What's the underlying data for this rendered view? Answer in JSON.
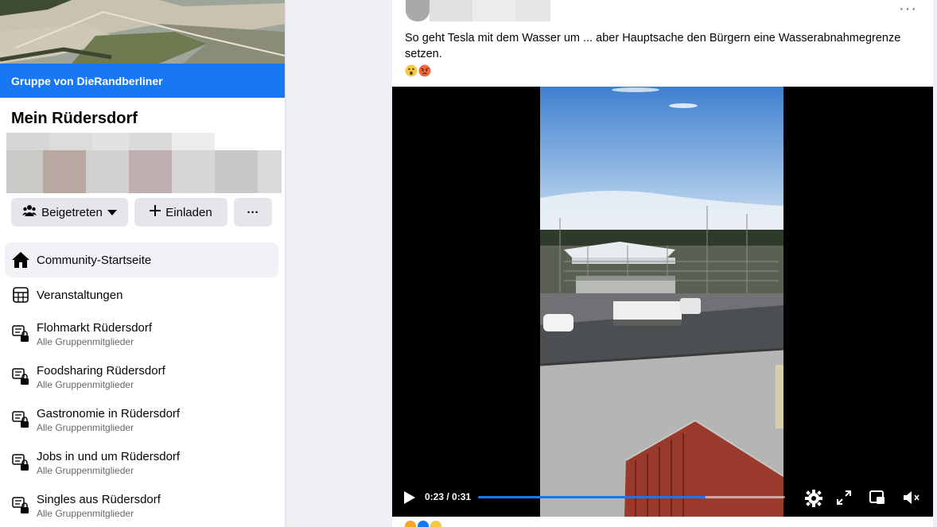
{
  "sidebar": {
    "group_by": "Gruppe von DieRandberliner",
    "group_name": "Mein Rüdersdorf",
    "buttons": {
      "joined": "Beigetreten",
      "invite": "Einladen",
      "more": "···"
    },
    "nav": [
      {
        "label": "Community-Startseite",
        "icon": "home-icon",
        "active": true
      },
      {
        "label": "Veranstaltungen",
        "icon": "calendar-icon"
      },
      {
        "label": "Flohmarkt Rüdersdorf",
        "sub": "Alle Gruppenmitglieder",
        "icon": "chat-lock-icon"
      },
      {
        "label": "Foodsharing Rüdersdorf",
        "sub": "Alle Gruppenmitglieder",
        "icon": "chat-lock-icon"
      },
      {
        "label": "Gastronomie in Rüdersdorf",
        "sub": "Alle Gruppenmitglieder",
        "icon": "chat-lock-icon"
      },
      {
        "label": "Jobs in und um Rüdersdorf",
        "sub": "Alle Gruppenmitglieder",
        "icon": "chat-lock-icon"
      },
      {
        "label": "Singles aus Rüdersdorf",
        "sub": "Alle Gruppenmitglieder",
        "icon": "chat-lock-icon"
      }
    ]
  },
  "post": {
    "more_label": "···",
    "text": "So geht Tesla mit dem Wasser um ... aber Hauptsache den Bürgern eine Wasserabnahmegrenze setzen.",
    "emojis": [
      "astonished-emoji",
      "angry-emoji"
    ],
    "video": {
      "time": "0:23 / 0:31",
      "progress": 0.74,
      "icons": [
        "play-icon",
        "settings-icon",
        "fullscreen-icon",
        "picture-in-picture-icon",
        "mute-icon"
      ]
    }
  },
  "colors": {
    "brand": "#1877f2",
    "page_bg": "#eef0f3",
    "secondary_text": "#65676b"
  }
}
